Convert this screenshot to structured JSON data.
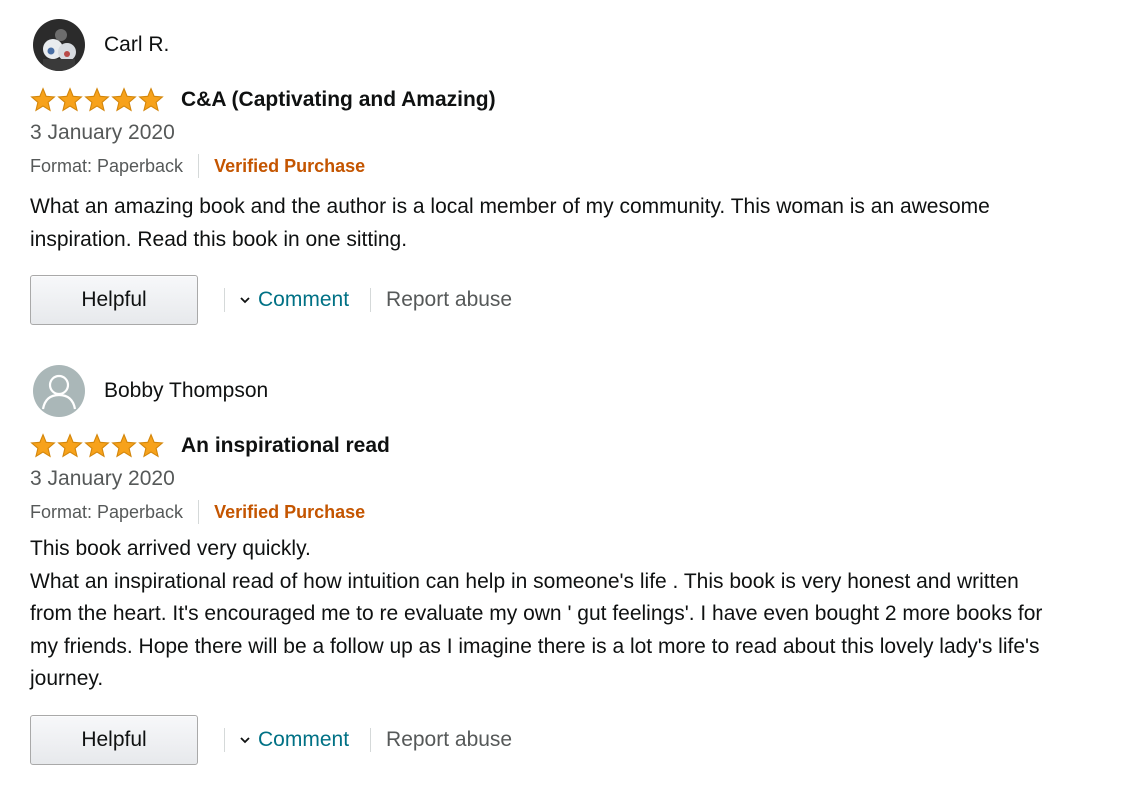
{
  "reviews": [
    {
      "author": "Carl R.",
      "rating": 5,
      "title": "C&A (Captivating and Amazing)",
      "date": "3 January 2020",
      "format": "Format: Paperback",
      "verified": "Verified Purchase",
      "body": "What an amazing book and the author is a local member of my community. This woman is an awesome\ninspiration. Read this book in one sitting.",
      "helpful_label": "Helpful",
      "comment_label": "Comment",
      "report_label": "Report abuse"
    },
    {
      "author": "Bobby Thompson",
      "rating": 5,
      "title": "An inspirational read",
      "date": "3 January 2020",
      "format": "Format: Paperback",
      "verified": "Verified Purchase",
      "body": "This book arrived very quickly.\nWhat an inspirational read of how intuition can help in someone's life . This book is very honest and written\nfrom the heart. It's encouraged me to re evaluate my own ' gut feelings'. I have even bought 2 more books for\nmy friends. Hope there will be a follow up as I imagine there is a lot more to read about this lovely lady's life's\njourney.",
      "helpful_label": "Helpful",
      "comment_label": "Comment",
      "report_label": "Report abuse"
    }
  ],
  "colors": {
    "star": "#f7a21b",
    "link": "#007185",
    "verified": "#c45500",
    "muted": "#565959"
  },
  "icons": {
    "star": "star-icon",
    "chevron": "chevron-down-icon",
    "avatar_default": "default-avatar-icon"
  }
}
